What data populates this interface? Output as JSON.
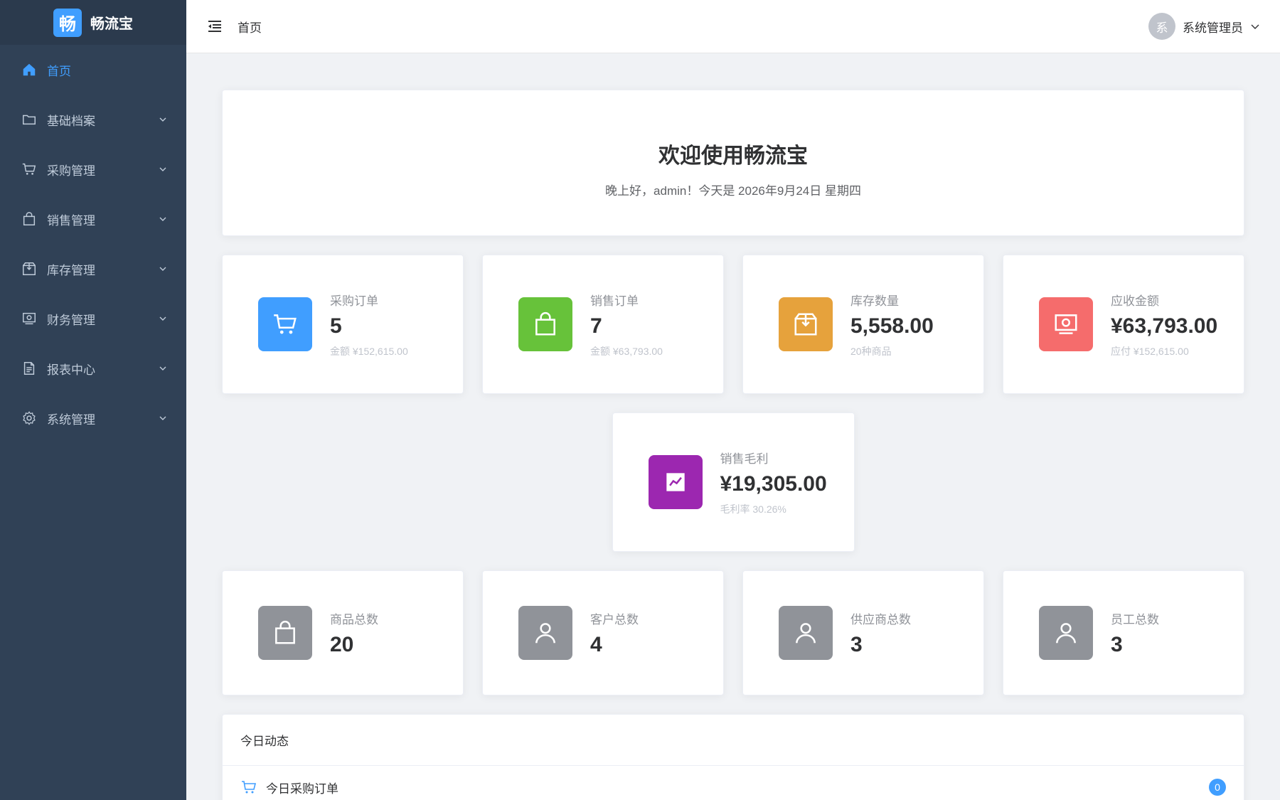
{
  "app": {
    "logo_char": "畅",
    "name": "畅流宝"
  },
  "sidebar": {
    "items": [
      {
        "label": "首页",
        "icon": "home-icon",
        "active": true
      },
      {
        "label": "基础档案",
        "icon": "folder-icon"
      },
      {
        "label": "采购管理",
        "icon": "cart-icon"
      },
      {
        "label": "销售管理",
        "icon": "bag-icon"
      },
      {
        "label": "库存管理",
        "icon": "box-icon"
      },
      {
        "label": "财务管理",
        "icon": "money-icon"
      },
      {
        "label": "报表中心",
        "icon": "document-icon"
      },
      {
        "label": "系统管理",
        "icon": "gear-icon"
      }
    ]
  },
  "header": {
    "breadcrumb": "首页",
    "user": {
      "avatar_char": "系",
      "name": "系统管理员"
    }
  },
  "welcome": {
    "title": "欢迎使用畅流宝",
    "subtitle": "晚上好，admin！今天是 2026年9月24日 星期四"
  },
  "stats": [
    {
      "label": "采购订单",
      "value": "5",
      "sub": "金额 ¥152,615.00",
      "color": "#409eff",
      "icon": "cart-icon"
    },
    {
      "label": "销售订单",
      "value": "7",
      "sub": "金额 ¥63,793.00",
      "color": "#67c23a",
      "icon": "bag-icon"
    },
    {
      "label": "库存数量",
      "value": "5,558.00",
      "sub": "20种商品",
      "color": "#e6a23c",
      "icon": "box-icon"
    },
    {
      "label": "应收金额",
      "value": "¥63,793.00",
      "sub": "应付 ¥152,615.00",
      "color": "#f56c6c",
      "icon": "money-icon"
    }
  ],
  "profit": {
    "label": "销售毛利",
    "value": "¥19,305.00",
    "sub": "毛利率 30.26%",
    "color": "#9c27b0",
    "icon": "trend-icon"
  },
  "counts": [
    {
      "label": "商品总数",
      "value": "20",
      "color": "#909399",
      "icon": "bag-icon"
    },
    {
      "label": "客户总数",
      "value": "4",
      "color": "#909399",
      "icon": "user-icon"
    },
    {
      "label": "供应商总数",
      "value": "3",
      "color": "#909399",
      "icon": "user-icon"
    },
    {
      "label": "员工总数",
      "value": "3",
      "color": "#909399",
      "icon": "user-icon"
    }
  ],
  "activity": {
    "title": "今日动态",
    "rows": [
      {
        "label": "今日采购订单",
        "count": "0",
        "icon": "cart-icon"
      }
    ]
  }
}
